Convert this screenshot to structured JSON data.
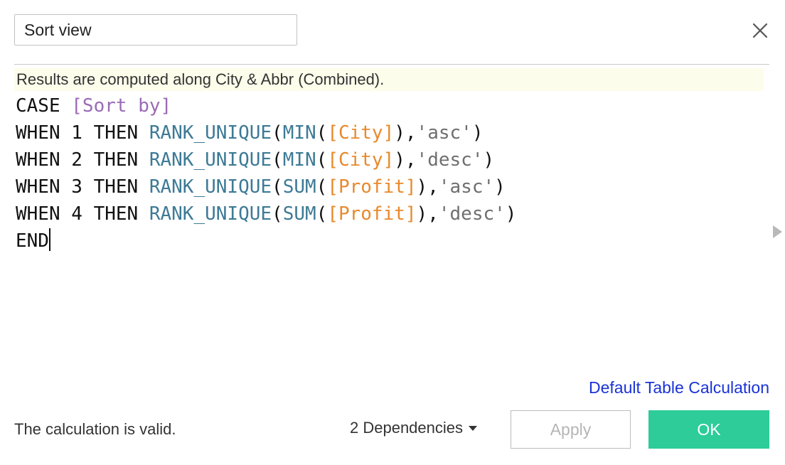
{
  "header": {
    "calc_name": "Sort view",
    "close_icon": "close-icon"
  },
  "info": {
    "text": "Results are computed along City & Abbr (Combined)."
  },
  "editor": {
    "lines": [
      [
        {
          "t": "CASE ",
          "k": "kw"
        },
        {
          "t": "[Sort by]",
          "k": "param"
        }
      ],
      [
        {
          "t": "WHEN 1 THEN ",
          "k": "kw"
        },
        {
          "t": "RANK_UNIQUE",
          "k": "fn"
        },
        {
          "t": "(",
          "k": "kw"
        },
        {
          "t": "MIN",
          "k": "fn"
        },
        {
          "t": "(",
          "k": "kw"
        },
        {
          "t": "[City]",
          "k": "fld"
        },
        {
          "t": "),",
          "k": "kw"
        },
        {
          "t": "'asc'",
          "k": "str"
        },
        {
          "t": ")",
          "k": "kw"
        }
      ],
      [
        {
          "t": "WHEN 2 THEN ",
          "k": "kw"
        },
        {
          "t": "RANK_UNIQUE",
          "k": "fn"
        },
        {
          "t": "(",
          "k": "kw"
        },
        {
          "t": "MIN",
          "k": "fn"
        },
        {
          "t": "(",
          "k": "kw"
        },
        {
          "t": "[City]",
          "k": "fld"
        },
        {
          "t": "),",
          "k": "kw"
        },
        {
          "t": "'desc'",
          "k": "str"
        },
        {
          "t": ")",
          "k": "kw"
        }
      ],
      [
        {
          "t": "WHEN 3 THEN ",
          "k": "kw"
        },
        {
          "t": "RANK_UNIQUE",
          "k": "fn"
        },
        {
          "t": "(",
          "k": "kw"
        },
        {
          "t": "SUM",
          "k": "fn"
        },
        {
          "t": "(",
          "k": "kw"
        },
        {
          "t": "[Profit]",
          "k": "fld"
        },
        {
          "t": "),",
          "k": "kw"
        },
        {
          "t": "'asc'",
          "k": "str"
        },
        {
          "t": ")",
          "k": "kw"
        }
      ],
      [
        {
          "t": "WHEN 4 THEN ",
          "k": "kw"
        },
        {
          "t": "RANK_UNIQUE",
          "k": "fn"
        },
        {
          "t": "(",
          "k": "kw"
        },
        {
          "t": "SUM",
          "k": "fn"
        },
        {
          "t": "(",
          "k": "kw"
        },
        {
          "t": "[Profit]",
          "k": "fld"
        },
        {
          "t": "),",
          "k": "kw"
        },
        {
          "t": "'desc'",
          "k": "str"
        },
        {
          "t": ")",
          "k": "kw"
        }
      ],
      [
        {
          "t": "END",
          "k": "kw"
        }
      ]
    ]
  },
  "colors": {
    "keyword": "#111111",
    "function": "#3d7a96",
    "field": "#e8892b",
    "parameter": "#9a6bb5",
    "string": "#6f6f6f",
    "info_background": "#fdfdeb",
    "link": "#1a33d6",
    "ok_button": "#2dcc98"
  },
  "expand_icon": "chevron-right-icon",
  "footer": {
    "default_table_calc_link": "Default Table Calculation",
    "status": "The calculation is valid.",
    "dependencies_label": "2 Dependencies",
    "dependencies_icon": "caret-down-icon",
    "apply_label": "Apply",
    "ok_label": "OK"
  }
}
